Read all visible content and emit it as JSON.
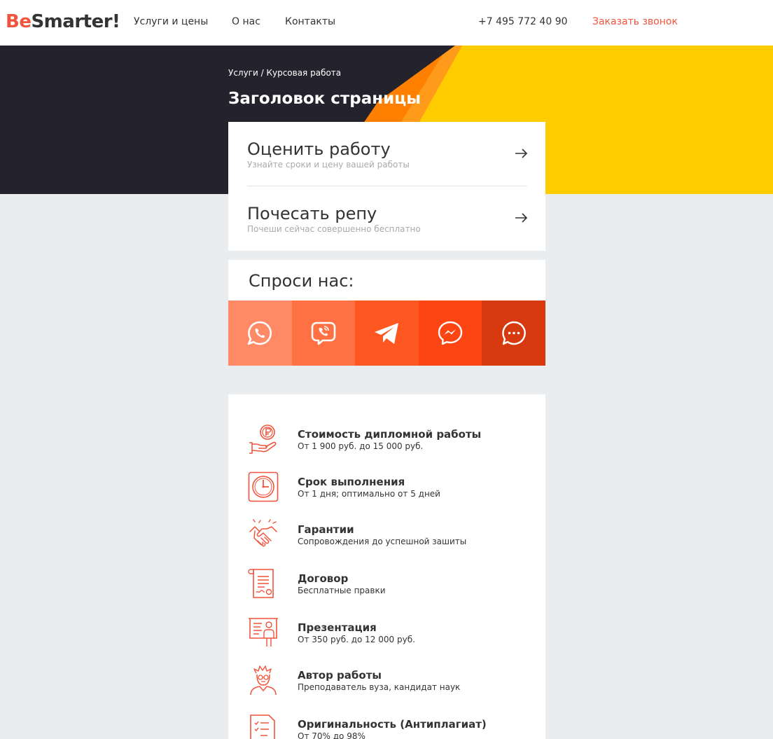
{
  "header": {
    "logo_accent": "Be",
    "logo_rest": "Smarter!",
    "nav": [
      "Услуги и цены",
      "О нас",
      "Контакты"
    ],
    "phone": "+7 495 772 40 90",
    "callback": "Заказать звонок"
  },
  "hero": {
    "breadcrumb": "Услуги / Курсовая работа",
    "title": "Заголовок страницы"
  },
  "actions": [
    {
      "title": "Оценить работу",
      "subtitle": "Узнайте сроки и цену вашей работы",
      "icon": "arrow-right-icon"
    },
    {
      "title": "Почесать репу",
      "subtitle": "Почеши сейчас совершенно бесплатно",
      "icon": "arrow-right-icon"
    }
  ],
  "ask": {
    "title": "Спроси нас:",
    "messengers": [
      {
        "name": "whatsapp",
        "color": "#ff8a65"
      },
      {
        "name": "viber",
        "color": "#ff7043"
      },
      {
        "name": "telegram",
        "color": "#ff5722"
      },
      {
        "name": "messenger",
        "color": "#fc4512"
      },
      {
        "name": "chat",
        "color": "#d83a10"
      }
    ]
  },
  "features": [
    {
      "icon": "coin-hand-icon",
      "title": "Стоимость дипломной работы",
      "subtitle": "От 1 900 руб. до 15 000 руб."
    },
    {
      "icon": "clock-icon",
      "title": "Срок выполнения",
      "subtitle": "От 1 дня; оптимально от 5 дней"
    },
    {
      "icon": "handshake-icon",
      "title": "Гарантии",
      "subtitle": "Сопровождения до успешной зашиты"
    },
    {
      "icon": "contract-icon",
      "title": "Договор",
      "subtitle": "Бесплатные правки"
    },
    {
      "icon": "presentation-icon",
      "title": "Презентация",
      "subtitle": "От 350 руб. до 12 000 руб."
    },
    {
      "icon": "author-icon",
      "title": "Автор работы",
      "subtitle": "Преподаватель вуза, кандидат наук"
    },
    {
      "icon": "document-check-icon",
      "title": "Оригинальность (Антиплагиат)",
      "subtitle": "От 70% до 98%"
    }
  ],
  "colors": {
    "accent": "#f0543c",
    "hero_dark": "#24232d",
    "hero_yellow": "#ffcc00",
    "hero_orange": "#ff7f00",
    "background": "#eaedef"
  }
}
